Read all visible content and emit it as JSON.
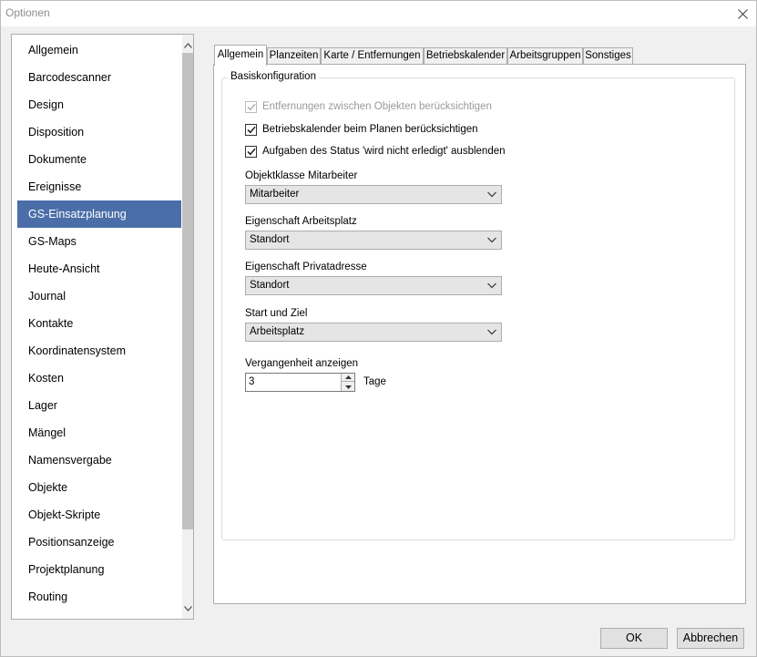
{
  "window": {
    "title": "Optionen"
  },
  "nav": {
    "items": [
      {
        "label": "Allgemein"
      },
      {
        "label": "Barcodescanner"
      },
      {
        "label": "Design"
      },
      {
        "label": "Disposition"
      },
      {
        "label": "Dokumente"
      },
      {
        "label": "Ereignisse"
      },
      {
        "label": "GS-Einsatzplanung"
      },
      {
        "label": "GS-Maps"
      },
      {
        "label": "Heute-Ansicht"
      },
      {
        "label": "Journal"
      },
      {
        "label": "Kontakte"
      },
      {
        "label": "Koordinatensystem"
      },
      {
        "label": "Kosten"
      },
      {
        "label": "Lager"
      },
      {
        "label": "Mängel"
      },
      {
        "label": "Namensvergabe"
      },
      {
        "label": "Objekte"
      },
      {
        "label": "Objekt-Skripte"
      },
      {
        "label": "Positionsanzeige"
      },
      {
        "label": "Projektplanung"
      },
      {
        "label": "Routing"
      }
    ],
    "selected": "GS-Einsatzplanung"
  },
  "tabs": [
    {
      "label": "Allgemein"
    },
    {
      "label": "Planzeiten"
    },
    {
      "label": "Karte / Entfernungen"
    },
    {
      "label": "Betriebskalender"
    },
    {
      "label": "Arbeitsgruppen"
    },
    {
      "label": "Sonstiges"
    }
  ],
  "active_tab": "Allgemein",
  "group": {
    "label": "Basiskonfiguration",
    "checkboxes": [
      {
        "label": "Entfernungen zwischen Objekten berücksichtigen",
        "checked": true,
        "disabled": true
      },
      {
        "label": "Betriebskalender beim Planen berücksichtigen",
        "checked": true,
        "disabled": false
      },
      {
        "label": "Aufgaben des Status 'wird nicht erledigt' ausblenden",
        "checked": true,
        "disabled": false
      }
    ],
    "selects": [
      {
        "label": "Objektklasse Mitarbeiter",
        "value": "Mitarbeiter"
      },
      {
        "label": "Eigenschaft Arbeitsplatz",
        "value": "Standort"
      },
      {
        "label": "Eigenschaft Privatadresse",
        "value": "Standort"
      },
      {
        "label": "Start und Ziel",
        "value": "Arbeitsplatz"
      }
    ],
    "past": {
      "label": "Vergangenheit anzeigen",
      "value": "3",
      "unit": "Tage"
    }
  },
  "buttons": {
    "ok": "OK",
    "cancel": "Abbrechen"
  }
}
